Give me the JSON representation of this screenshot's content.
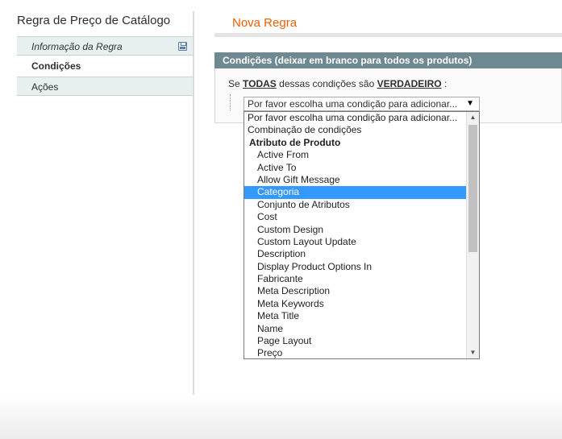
{
  "sidebar": {
    "title": "Regra de Preço de Catálogo",
    "tabs": [
      {
        "label": "Informação da Regra"
      },
      {
        "label": "Condições"
      },
      {
        "label": "Ações"
      }
    ]
  },
  "main": {
    "title": "Nova Regra",
    "fieldset_title": "Condições (deixar em branco para todos os produtos)",
    "condition": {
      "prefix": "Se",
      "aggregator": "TODAS",
      "middle": "dessas condições são",
      "value": "VERDADEIRO",
      "suffix": ":"
    },
    "select_value": "Por favor escolha uma condição para adicionar...",
    "dropdown": {
      "options": [
        "Por favor escolha uma condição para adicionar...",
        "Combinação de condições",
        "Atributo de Produto",
        "Active From",
        "Active To",
        "Allow Gift Message",
        "Categoria",
        "Conjunto de Atributos",
        "Cost",
        "Custom Design",
        "Custom Layout Update",
        "Description",
        "Display Product Options In",
        "Fabricante",
        "Meta Description",
        "Meta Keywords",
        "Meta Title",
        "Name",
        "Page Layout",
        "Preço"
      ],
      "selected": "Categoria",
      "group_header": "Atributo de Produto"
    }
  },
  "colors": {
    "accent_title": "#eb5e00",
    "fieldset_header_bg": "#6f8992",
    "selected_option_bg": "#3399ff",
    "tab_bg": "#e7efef"
  },
  "icons": {
    "save": "save-icon",
    "select_arrow": "chevron-down-icon",
    "scroll_up": "scroll-up-icon",
    "scroll_down": "scroll-down-icon"
  }
}
